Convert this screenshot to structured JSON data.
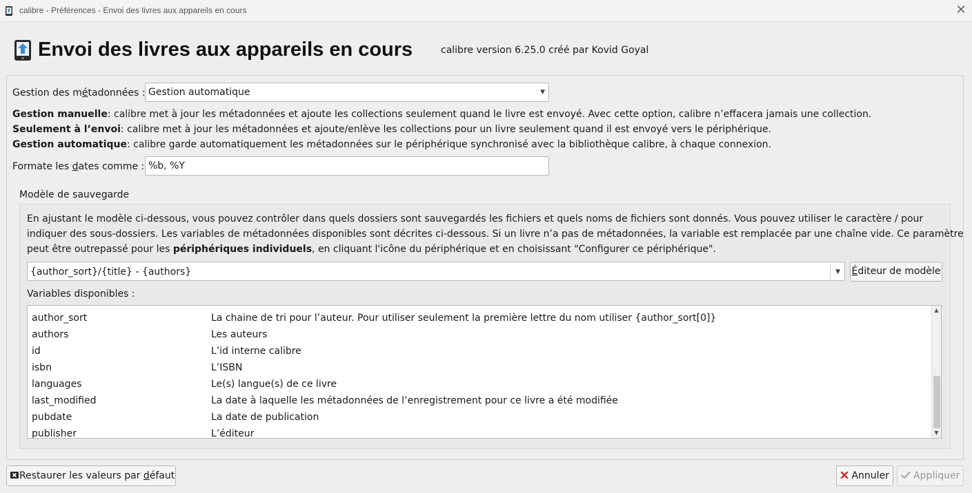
{
  "window": {
    "title": "calibre - Préférences - Envoi des livres aux appareils en cours",
    "close_glyph": "✕",
    "app_icon": "calibre-device-icon"
  },
  "header": {
    "title": "Envoi des livres aux appareils en cours",
    "subtitle": "calibre version 6.25.0 créé par Kovid Goyal",
    "icon": "device-send-icon",
    "accent": "#3a8ad6"
  },
  "metadata": {
    "label_pre": "Gestion des m",
    "label_mnemonic": "é",
    "label_post": "tadonnées :",
    "selected": "Gestion automatique",
    "descriptions": [
      {
        "term": "Gestion manuelle",
        "text": ": calibre met à jour les métadonnées et ajoute les collections seulement quand le livre est envoyé. Avec cette option, calibre n’effacera jamais une collection."
      },
      {
        "term": "Seulement à l’envoi",
        "text": ": calibre met à jour les métadonnées et ajoute/enlève les collections pour un livre seulement quand il est envoyé vers le périphérique."
      },
      {
        "term": "Gestion automatique",
        "text": ": calibre garde automatiquement les métadonnées sur le périphérique synchronisé avec la bibliothèque calibre, à chaque connexion."
      }
    ]
  },
  "date_format": {
    "label_pre": "Formate les ",
    "label_mnemonic": "d",
    "label_post": "ates comme :",
    "value": "%b, %Y"
  },
  "save_template": {
    "group_title": "Modèle de sauvegarde",
    "intro_line1": "En ajustant le modèle ci-dessous, vous pouvez contrôler dans quels dossiers sont sauvegardés les fichiers et quels noms de fichiers sont donnés. Vous pouvez utiliser le caractère / pour",
    "intro_line2": "indiquer des sous-dossiers. Les variables de métadonnées disponibles sont décrites ci-dessous. Si un livre n’a pas de métadonnées, la variable est remplacée par une chaîne vide. Ce paramètre",
    "intro_line3_pre": "peut être outrepassé pour les ",
    "intro_line3_bold": "périphériques individuels",
    "intro_line3_post": ", en cliquant l'icône du périphérique et en choisissant \"Configurer ce périphérique\".",
    "template_value": "{author_sort}/{title} - {authors}",
    "editor_button_mnemonic": "É",
    "editor_button_rest": "diteur de modèle",
    "vars_label": "Variables disponibles :",
    "variables": [
      {
        "name": "author_sort",
        "desc": "La chaine de tri pour l’auteur. Pour utiliser seulement la première lettre du nom utiliser {author_sort[0]}"
      },
      {
        "name": "authors",
        "desc": "Les auteurs"
      },
      {
        "name": "id",
        "desc": "L’id interne calibre"
      },
      {
        "name": "isbn",
        "desc": "L’ISBN"
      },
      {
        "name": "languages",
        "desc": "Le(s) langue(s) de ce livre"
      },
      {
        "name": "last_modified",
        "desc": "La date à laquelle les métadonnées de l’enregistrement pour ce livre a été modifiée"
      },
      {
        "name": "pubdate",
        "desc": "La date de publication"
      },
      {
        "name": "publisher",
        "desc": "L’éditeur"
      }
    ]
  },
  "footer": {
    "restore_pre": "Restaurer les valeurs par ",
    "restore_mnemonic": "d",
    "restore_post": "éfaut",
    "restore_icon": "restore-icon",
    "cancel_label": "Annuler",
    "cancel_icon": "x-icon",
    "cancel_color": "#d32f2f",
    "apply_label": "Appliquer",
    "apply_icon": "checkmark-icon",
    "apply_disabled_color": "#9a9a9a"
  }
}
